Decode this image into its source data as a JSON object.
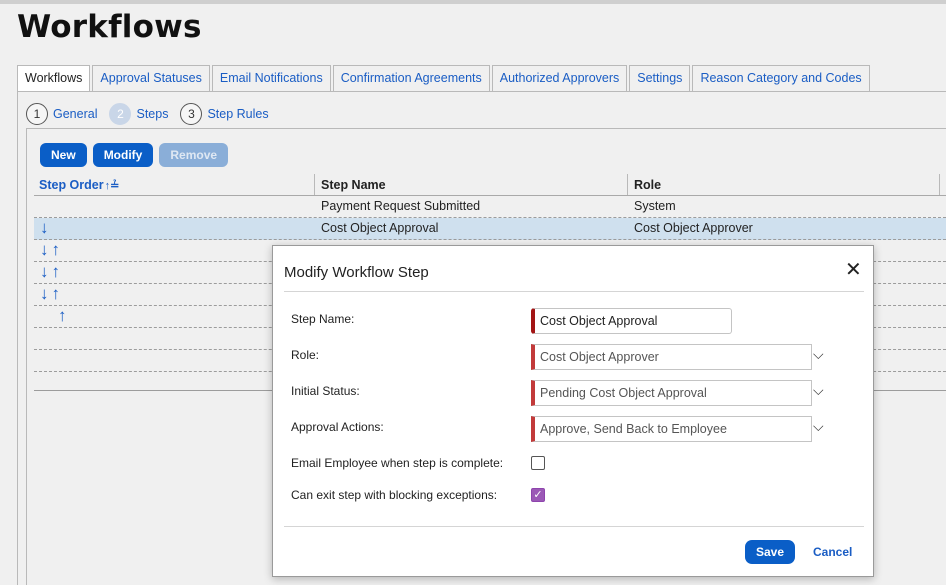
{
  "page": {
    "title": "Workflows"
  },
  "tabs": [
    {
      "label": "Workflows"
    },
    {
      "label": "Approval Statuses"
    },
    {
      "label": "Email Notifications"
    },
    {
      "label": "Confirmation Agreements"
    },
    {
      "label": "Authorized Approvers"
    },
    {
      "label": "Settings"
    },
    {
      "label": "Reason Category and Codes"
    }
  ],
  "wizard": [
    {
      "num": "1",
      "label": "General"
    },
    {
      "num": "2",
      "label": "Steps"
    },
    {
      "num": "3",
      "label": "Step Rules"
    }
  ],
  "toolbar": {
    "new": "New",
    "modify": "Modify",
    "remove": "Remove"
  },
  "grid": {
    "headers": {
      "step_order": "Step Order",
      "step_name": "Step Name",
      "role": "Role"
    },
    "rows": [
      {
        "down": "",
        "up": "",
        "step_name": "Payment Request Submitted",
        "role": "System"
      },
      {
        "down": "↓",
        "up": "",
        "step_name": "Cost Object Approval",
        "role": "Cost Object Approver"
      },
      {
        "down": "↓",
        "up": "↑",
        "step_name": "",
        "role": ""
      },
      {
        "down": "↓",
        "up": "↑",
        "step_name": "",
        "role": ""
      },
      {
        "down": "↓",
        "up": "↑",
        "step_name": "",
        "role": ""
      },
      {
        "down": "",
        "up": "↑",
        "step_name": "",
        "role": ""
      },
      {
        "down": "",
        "up": "",
        "step_name": "",
        "role": ""
      },
      {
        "down": "",
        "up": "",
        "step_name": "",
        "role": ""
      }
    ]
  },
  "modal": {
    "title": "Modify Workflow Step",
    "close": "✕",
    "fields": {
      "step_name_label": "Step Name:",
      "step_name_value": "Cost Object Approval",
      "role_label": "Role:",
      "role_value": "Cost Object Approver",
      "initial_status_label": "Initial Status:",
      "initial_status_value": "Pending Cost Object Approval",
      "approval_actions_label": "Approval Actions:",
      "approval_actions_value": "Approve, Send Back to Employee",
      "email_label": "Email Employee when step is complete:",
      "exit_label": "Can exit step with blocking exceptions:"
    },
    "email_checked": false,
    "exit_checked": true,
    "save": "Save",
    "cancel": "Cancel"
  }
}
